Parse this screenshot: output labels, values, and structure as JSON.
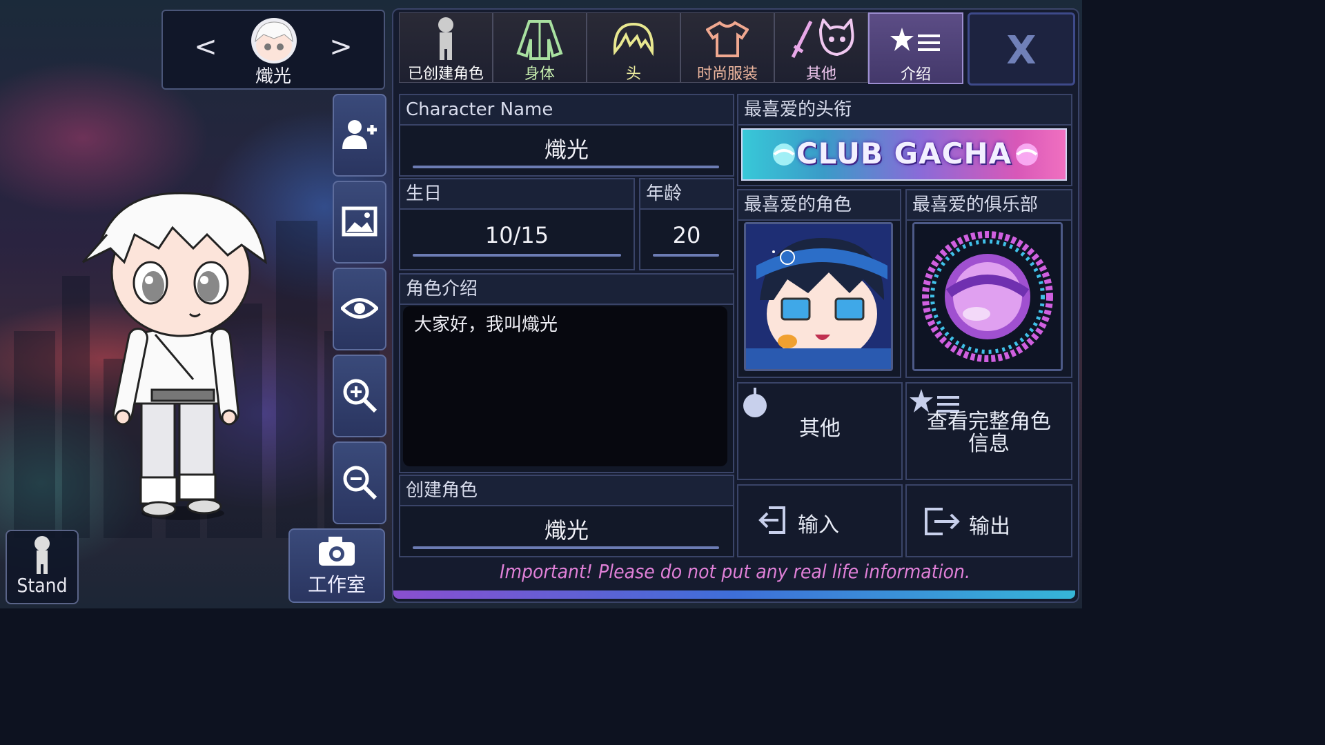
{
  "character": {
    "name": "熾光",
    "prev_label": "<",
    "next_label": ">"
  },
  "tabs": [
    {
      "label": "已创建角色",
      "icon": "person-silhouette-icon",
      "color": "#ffffff"
    },
    {
      "label": "身体",
      "icon": "shirt-jacket-icon",
      "color": "#c8f0b0"
    },
    {
      "label": "头",
      "icon": "hair-icon",
      "color": "#f0f0a0"
    },
    {
      "label": "时尚服装",
      "icon": "tshirt-icon",
      "color": "#f0b8a0"
    },
    {
      "label": "其他",
      "icon": "sword-cat-icon",
      "color": "#f0c8f0"
    },
    {
      "label": "介绍",
      "icon": "star-list-icon",
      "color": "#ffffff"
    }
  ],
  "close_label": "X",
  "fields": {
    "character_name": {
      "label": "Character Name",
      "value": "熾光"
    },
    "birthday": {
      "label": "生日",
      "value": "10/15"
    },
    "age": {
      "label": "年龄",
      "value": "20"
    },
    "intro": {
      "label": "角色介绍",
      "value": "大家好，我叫熾光"
    },
    "creator": {
      "label": "创建角色",
      "value": "熾光"
    }
  },
  "favorites": {
    "title": {
      "label": "最喜爱的头衔",
      "banner": "CLUB GACHA"
    },
    "character": {
      "label": "最喜爱的角色"
    },
    "club": {
      "label": "最喜爱的俱乐部"
    }
  },
  "buttons": {
    "other": "其他",
    "view_full": "查看完整角色信息",
    "import": "输入",
    "export": "输出"
  },
  "pose_label": "Stand",
  "studio_label": "工作室",
  "warning": "Important! Please do not put any real life information."
}
